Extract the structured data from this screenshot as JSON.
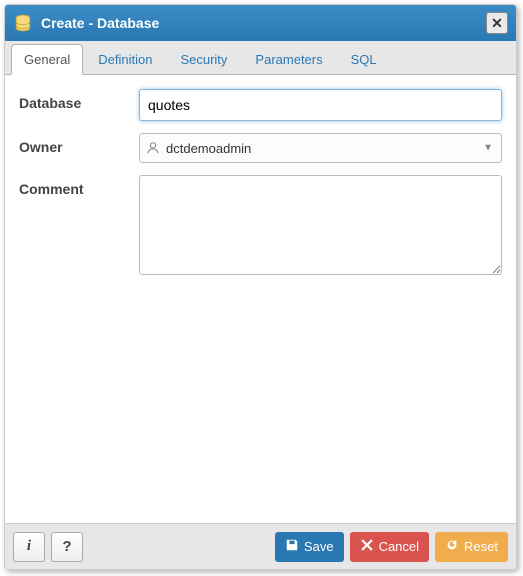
{
  "header": {
    "title": "Create - Database"
  },
  "tabs": [
    {
      "label": "General",
      "active": true
    },
    {
      "label": "Definition",
      "active": false
    },
    {
      "label": "Security",
      "active": false
    },
    {
      "label": "Parameters",
      "active": false
    },
    {
      "label": "SQL",
      "active": false
    }
  ],
  "form": {
    "database_label": "Database",
    "database_value": "quotes",
    "owner_label": "Owner",
    "owner_value": "dctdemoadmin",
    "comment_label": "Comment",
    "comment_value": ""
  },
  "footer": {
    "info_label": "i",
    "help_label": "?",
    "save_label": "Save",
    "cancel_label": "Cancel",
    "reset_label": "Reset"
  }
}
